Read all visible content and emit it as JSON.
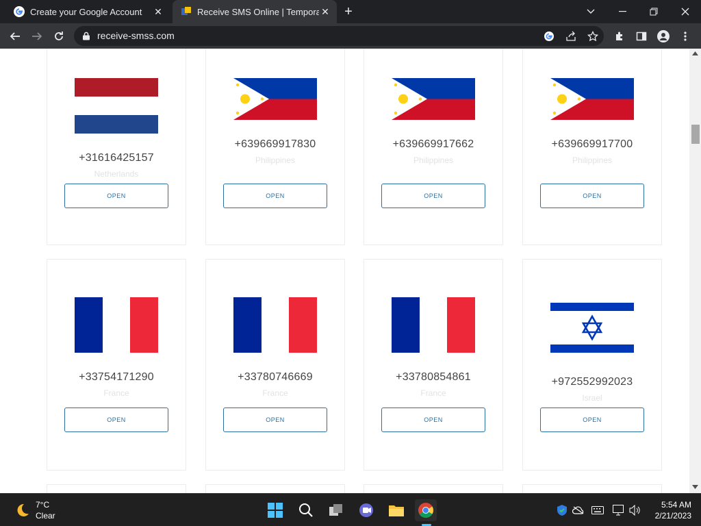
{
  "browser": {
    "tabs": [
      {
        "title": "Create your Google Account",
        "favicon": "google-g-icon"
      },
      {
        "title": "Receive SMS Online | Temporary",
        "favicon": "receive-smss-icon"
      }
    ],
    "url": "receive-smss.com"
  },
  "numbers": [
    {
      "phone": "+31616425157",
      "country": "Netherlands",
      "flag": "netherlands",
      "button": "OPEN"
    },
    {
      "phone": "+639669917830",
      "country": "Philippines",
      "flag": "philippines",
      "button": "OPEN"
    },
    {
      "phone": "+639669917662",
      "country": "Philippines",
      "flag": "philippines",
      "button": "OPEN"
    },
    {
      "phone": "+639669917700",
      "country": "Philippines",
      "flag": "philippines",
      "button": "OPEN"
    },
    {
      "phone": "+33754171290",
      "country": "France",
      "flag": "france",
      "button": "OPEN"
    },
    {
      "phone": "+33780746669",
      "country": "France",
      "flag": "france",
      "button": "OPEN"
    },
    {
      "phone": "+33780854861",
      "country": "France",
      "flag": "france",
      "button": "OPEN"
    },
    {
      "phone": "+972552992023",
      "country": "Israel",
      "flag": "israel",
      "button": "OPEN"
    }
  ],
  "taskbar": {
    "weather": {
      "temp": "7°C",
      "condition": "Clear"
    },
    "clock": {
      "time": "5:54 AM",
      "date": "2/21/2023"
    }
  },
  "colors": {
    "accent": "#2b6fa0",
    "chrome_dark": "#202124",
    "chrome_toolbar": "#35363a"
  }
}
